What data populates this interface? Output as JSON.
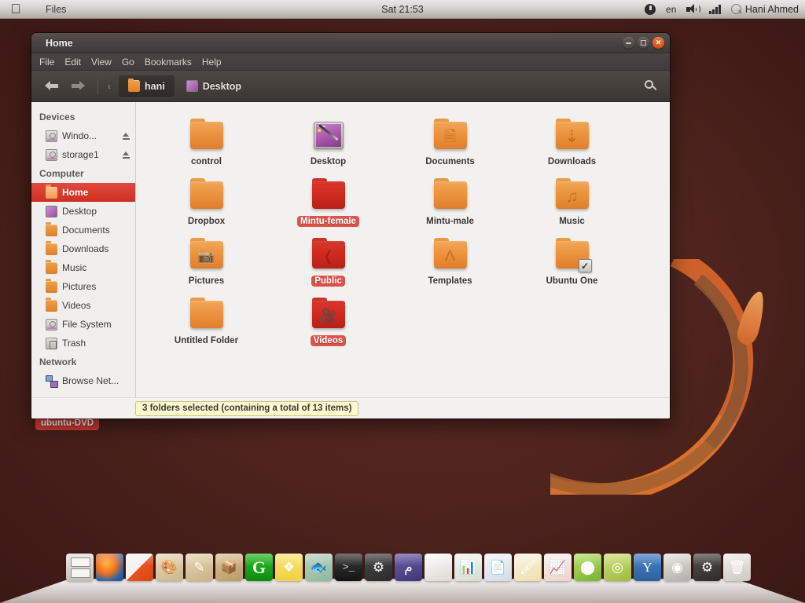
{
  "panel": {
    "apple_logo": "apple-logo",
    "app_name": "Files",
    "clock": "Sat 21:53",
    "indicators": {
      "session": "power-icon",
      "language": "en",
      "volume": "volume-icon",
      "signal": "signal-icon",
      "user_icon": "user-icon",
      "user_name": "Hani Ahmed"
    }
  },
  "desktop": {
    "icon_label": "ubuntu-DVD"
  },
  "window": {
    "title": "Home",
    "buttons": {
      "minimize": "minimize-icon",
      "maximize": "maximize-icon",
      "close": "close-icon"
    },
    "menu": [
      "File",
      "Edit",
      "View",
      "Go",
      "Bookmarks",
      "Help"
    ],
    "toolbar": {
      "back": "back-arrow-icon",
      "forward": "forward-arrow-icon",
      "overflow": "‹",
      "search": "search-icon",
      "breadcrumbs": [
        {
          "label": "hani",
          "icon": "home-folder-icon",
          "active": true
        },
        {
          "label": "Desktop",
          "icon": "desktop-icon",
          "active": false
        }
      ]
    },
    "sidebar": [
      {
        "type": "header",
        "label": "Devices"
      },
      {
        "type": "item",
        "label": "Windo...",
        "icon": "drive-icon",
        "eject": true,
        "selected": false
      },
      {
        "type": "item",
        "label": "storage1",
        "icon": "drive-icon",
        "eject": true,
        "selected": false
      },
      {
        "type": "header",
        "label": "Computer"
      },
      {
        "type": "item",
        "label": "Home",
        "icon": "home-folder-icon",
        "eject": false,
        "selected": true
      },
      {
        "type": "item",
        "label": "Desktop",
        "icon": "desktop-icon",
        "eject": false,
        "selected": false
      },
      {
        "type": "item",
        "label": "Documents",
        "icon": "documents-folder-icon",
        "eject": false,
        "selected": false
      },
      {
        "type": "item",
        "label": "Downloads",
        "icon": "downloads-folder-icon",
        "eject": false,
        "selected": false
      },
      {
        "type": "item",
        "label": "Music",
        "icon": "music-folder-icon",
        "eject": false,
        "selected": false
      },
      {
        "type": "item",
        "label": "Pictures",
        "icon": "pictures-folder-icon",
        "eject": false,
        "selected": false
      },
      {
        "type": "item",
        "label": "Videos",
        "icon": "videos-folder-icon",
        "eject": false,
        "selected": false
      },
      {
        "type": "item",
        "label": "File System",
        "icon": "drive-icon",
        "eject": false,
        "selected": false
      },
      {
        "type": "item",
        "label": "Trash",
        "icon": "trash-icon",
        "eject": false,
        "selected": false
      },
      {
        "type": "header",
        "label": "Network"
      },
      {
        "type": "item",
        "label": "Browse Net...",
        "icon": "network-icon",
        "eject": false,
        "selected": false
      }
    ],
    "files": [
      {
        "name": "control",
        "icon": "folder-plain-icon",
        "glyph": "",
        "selected": false
      },
      {
        "name": "Desktop",
        "icon": "desktop-image-icon",
        "glyph": "",
        "selected": false
      },
      {
        "name": "Documents",
        "icon": "folder-documents-icon",
        "glyph": "὜E",
        "selected": false
      },
      {
        "name": "Downloads",
        "icon": "folder-downloads-icon",
        "glyph": "↓",
        "selected": false
      },
      {
        "name": "Dropbox",
        "icon": "folder-plain-icon",
        "glyph": "",
        "selected": false
      },
      {
        "name": "Mintu-female",
        "icon": "folder-plain-icon",
        "glyph": "",
        "selected": true
      },
      {
        "name": "Mintu-male",
        "icon": "folder-plain-icon",
        "glyph": "",
        "selected": false
      },
      {
        "name": "Music",
        "icon": "folder-music-icon",
        "glyph": "♫",
        "selected": false
      },
      {
        "name": "Pictures",
        "icon": "folder-pictures-icon",
        "glyph": "□",
        "selected": false
      },
      {
        "name": "Public",
        "icon": "folder-public-icon",
        "glyph": "≋",
        "selected": true
      },
      {
        "name": "Templates",
        "icon": "folder-templates-icon",
        "glyph": "Λ",
        "selected": false
      },
      {
        "name": "Ubuntu One",
        "icon": "folder-checked-icon",
        "glyph": "",
        "selected": false
      },
      {
        "name": "Untitled Folder",
        "icon": "folder-plain-icon",
        "glyph": "",
        "selected": false
      },
      {
        "name": "Videos",
        "icon": "folder-videos-icon",
        "glyph": "⌘",
        "selected": true
      }
    ],
    "status": "3 folders selected (containing a total of 13 items)"
  },
  "dock": {
    "items": [
      {
        "name": "file-manager",
        "cls": "d-files",
        "text": ""
      },
      {
        "name": "firefox",
        "cls": "d-ff",
        "text": ""
      },
      {
        "name": "preferences",
        "cls": "d-prefs",
        "text": ""
      },
      {
        "name": "paint",
        "cls": "d-paint",
        "text": "🎨"
      },
      {
        "name": "drawing",
        "cls": "d-draw",
        "text": "✎"
      },
      {
        "name": "archive",
        "cls": "d-arch",
        "text": "📦"
      },
      {
        "name": "gimp",
        "cls": "d-gimp",
        "text": "G"
      },
      {
        "name": "dropbox",
        "cls": "d-drop",
        "text": "❖"
      },
      {
        "name": "fish-app",
        "cls": "d-fish",
        "text": "🐟"
      },
      {
        "name": "terminal",
        "cls": "d-term",
        "text": ">_"
      },
      {
        "name": "system-tools",
        "cls": "d-gears",
        "text": "⚙"
      },
      {
        "name": "arabic-app",
        "cls": "d-arab",
        "text": "م"
      },
      {
        "name": "libreoffice",
        "cls": "d-lo",
        "text": ""
      },
      {
        "name": "libreoffice-calc",
        "cls": "d-calc",
        "text": "📊"
      },
      {
        "name": "libreoffice-writer",
        "cls": "d-writer",
        "text": "📄"
      },
      {
        "name": "libreoffice-draw",
        "cls": "d-drawapp",
        "text": "🖌"
      },
      {
        "name": "libreoffice-impress",
        "cls": "d-impress",
        "text": "📈"
      },
      {
        "name": "ubuntu-software",
        "cls": "d-usc",
        "text": "⬤"
      },
      {
        "name": "spiral-app",
        "cls": "d-spiral",
        "text": "◎"
      },
      {
        "name": "y-ppa-manager",
        "cls": "d-yppa",
        "text": "Y"
      },
      {
        "name": "camera",
        "cls": "d-cam",
        "text": "◉"
      },
      {
        "name": "settings",
        "cls": "d-gear2",
        "text": "⚙"
      },
      {
        "name": "trash",
        "cls": "d-trash",
        "text": "🗑"
      }
    ]
  }
}
